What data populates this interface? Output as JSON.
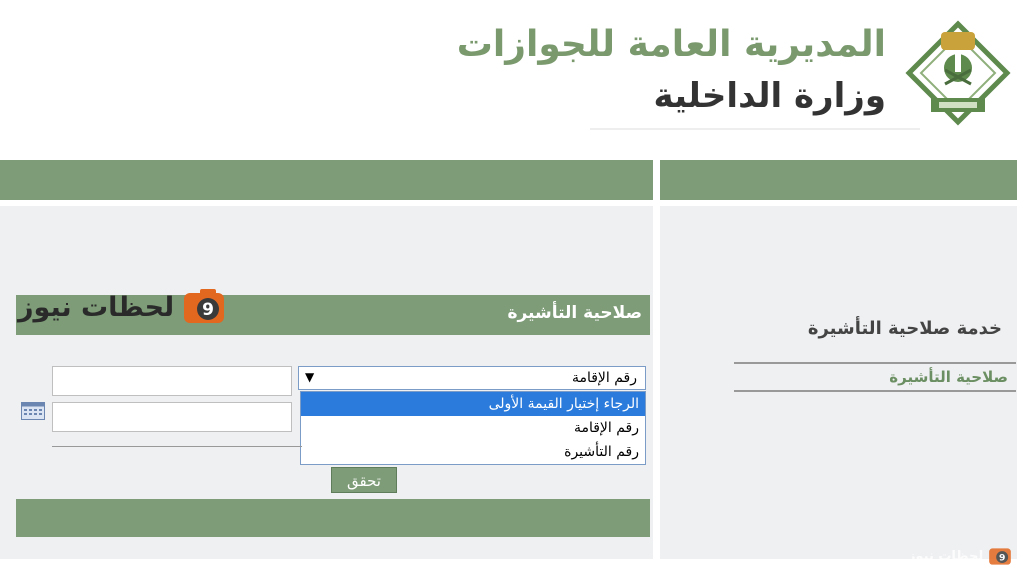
{
  "header": {
    "title_main": "المديرية العامة للجوازات",
    "title_sub": "وزارة الداخلية"
  },
  "brand": {
    "text": "لحظات نيوز"
  },
  "form": {
    "section_title": "صلاحية التأشيرة",
    "select_value": "رقم الإقامة",
    "options": [
      "الرجاء إختيار القيمة الأولى",
      "رقم الإقامة",
      "رقم التأشيرة"
    ],
    "submit_label": "تحقق"
  },
  "sidebar": {
    "service_title": "خدمة صلاحية التأشيرة",
    "link_label": "صلاحية التأشيرة"
  },
  "watermark": {
    "text": "لحظات نيوز"
  },
  "colors": {
    "accent_green": "#7d9c77",
    "panel_bg": "#eff0f2",
    "selected_option": "#2b7bdc"
  }
}
